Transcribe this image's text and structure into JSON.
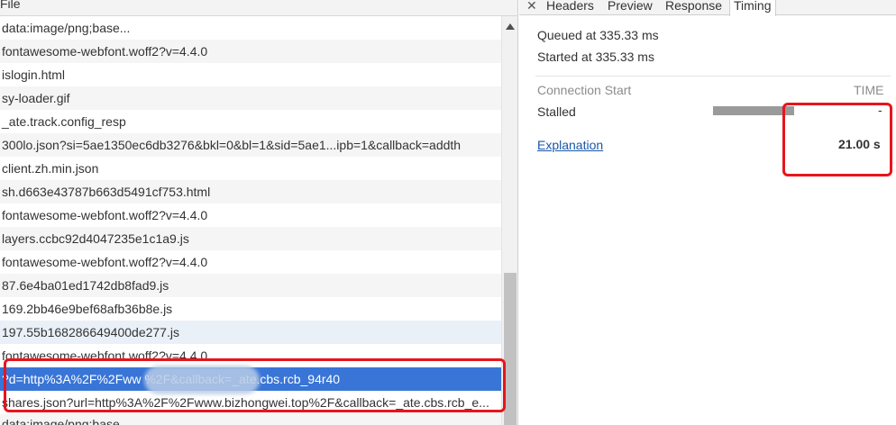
{
  "requests": {
    "column_header": "File",
    "rows": [
      "data:image/png;base...",
      "fontawesome-webfont.woff2?v=4.4.0",
      "islogin.html",
      "sy-loader.gif",
      "_ate.track.config_resp",
      "300lo.json?si=5ae1350ec6db3276&bkl=0&bl=1&sid=5ae1...ipb=1&callback=addth",
      "client.zh.min.json",
      "sh.d663e43787b663d5491cf753.html",
      "fontawesome-webfont.woff2?v=4.4.0",
      "layers.ccbc92d4047235e1c1a9.js",
      "fontawesome-webfont.woff2?v=4.4.0",
      "87.6e4ba01ed1742db8fad9.js",
      "169.2bb46e9bef68afb36b8e.js",
      "197.55b168286649400de277.js",
      "fontawesome-webfont.woff2?v=4.4.0",
      "?d=http%3A%2F%2Fww                    %2F&callback=_ate.cbs.rcb_94r40",
      "shares.json?url=http%3A%2F%2Fwww.bizhongwei.top%2F&callback=_ate.cbs.rcb_e...",
      "data:image/png;base..."
    ]
  },
  "tabs": {
    "close": "✕",
    "headers": "Headers",
    "preview": "Preview",
    "response": "Response",
    "timing": "Timing"
  },
  "timing": {
    "queued": "Queued at 335.33 ms",
    "started": "Started at 335.33 ms",
    "connection_start": "Connection Start",
    "time_header": "TIME",
    "stalled_label": "Stalled",
    "stalled_value": "-",
    "explanation": "Explanation",
    "total": "21.00 s"
  },
  "colors": {
    "selected_row": "#3875d7",
    "highlight_box": "#e8141c",
    "link": "#1a57a8"
  }
}
